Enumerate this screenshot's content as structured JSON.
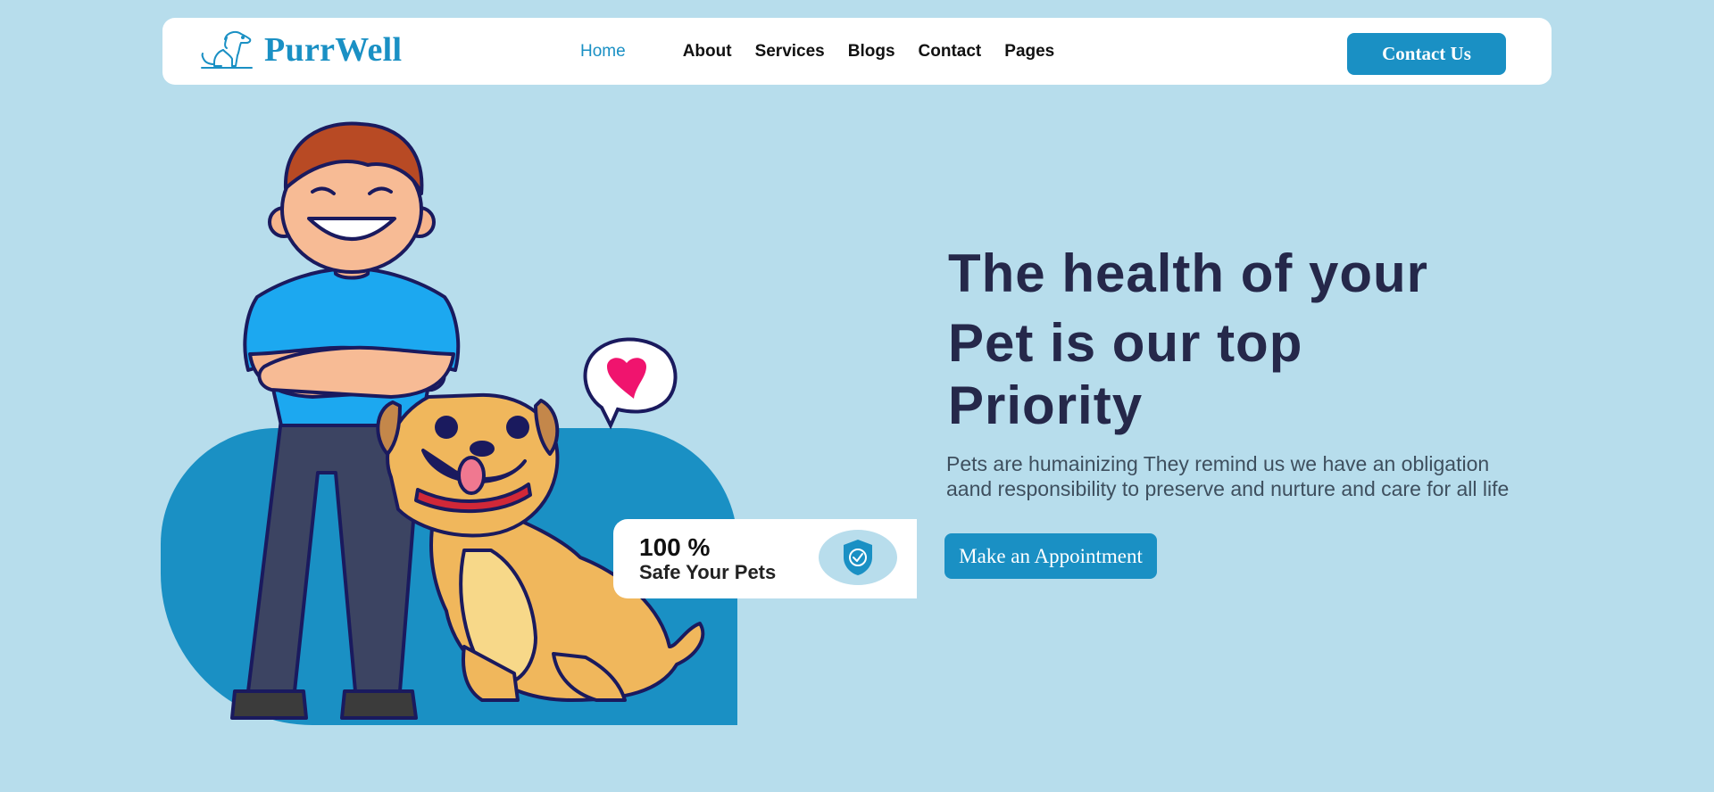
{
  "brand": {
    "name": "PurrWell",
    "logo_icon": "dog-outline-icon"
  },
  "nav": {
    "items": [
      {
        "label": "Home",
        "active": true
      },
      {
        "label": "About"
      },
      {
        "label": "Services"
      },
      {
        "label": "Blogs"
      },
      {
        "label": "Contact"
      },
      {
        "label": "Pages"
      }
    ],
    "cta_label": "Contact Us"
  },
  "hero": {
    "headline_lines": [
      "The health of your",
      "Pet is our top",
      "Priority"
    ],
    "subtext": "Pets are humainizing They remind us we have an obligation aand responsibility to preserve and nurture and care for all life",
    "cta_label": "Make an Appointment",
    "badge": {
      "percent": "100 %",
      "label": "Safe Your Pets",
      "icon": "shield-check-icon"
    },
    "illustration": "boy-with-dog-illustration"
  },
  "colors": {
    "background": "#b7ddec",
    "accent": "#1a90c4",
    "headline": "#25284a",
    "body_text": "#3e4f5e"
  }
}
